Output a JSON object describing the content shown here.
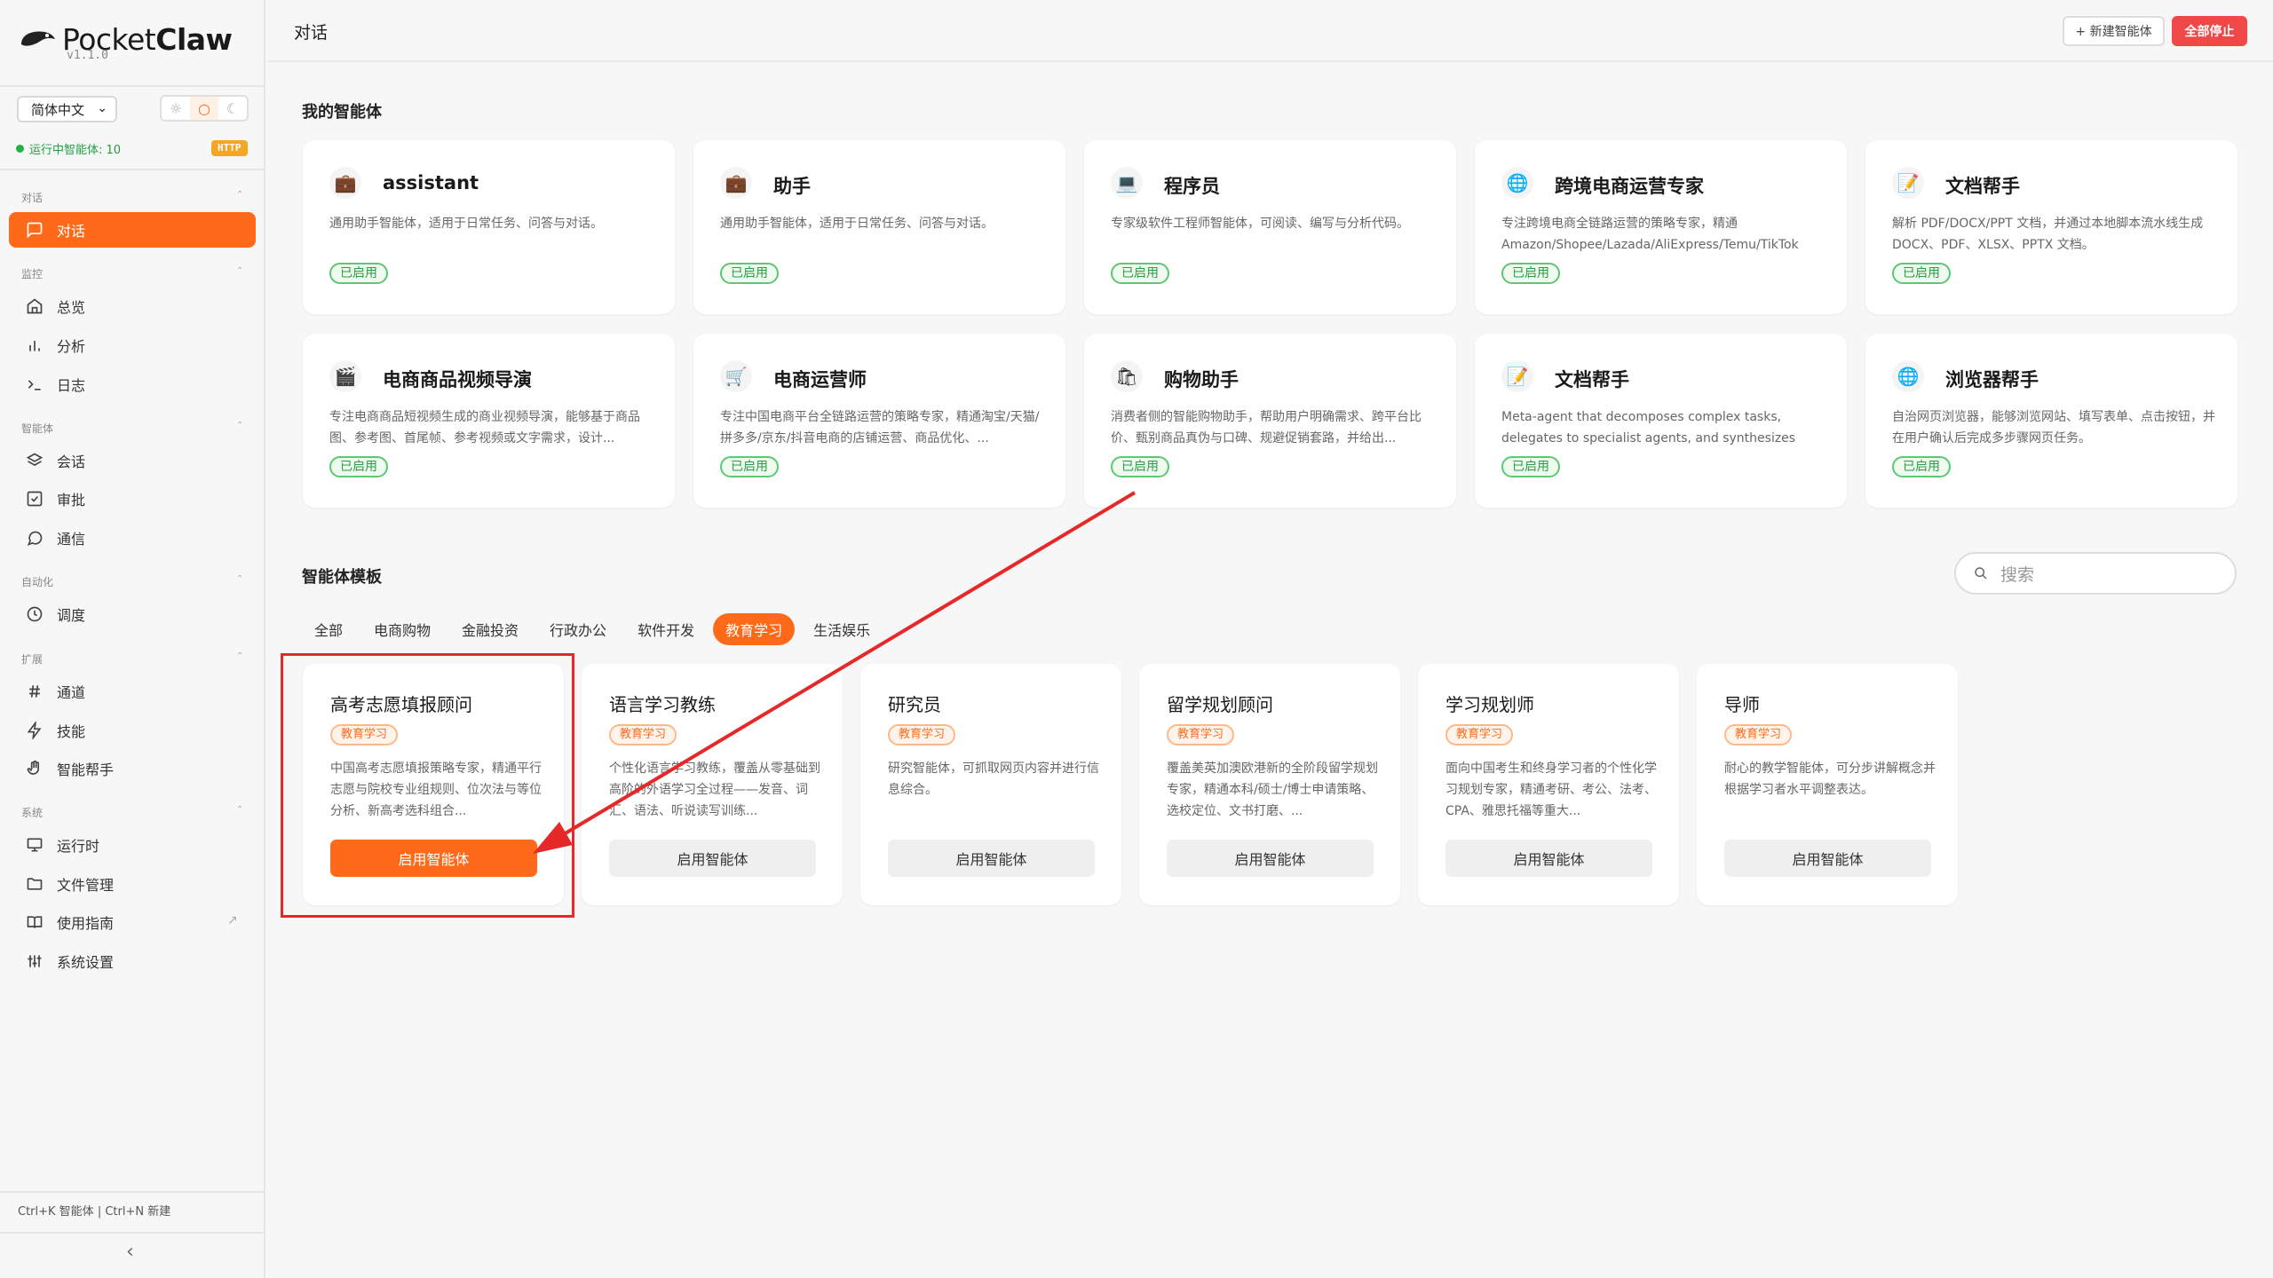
{
  "app": {
    "name_light": "Pocket",
    "name_bold": "Claw",
    "version": "v1.1.0"
  },
  "sidebar": {
    "language": "简体中文",
    "running_label": "运行中智能体: 10",
    "http_badge": "HTTP",
    "sections": [
      {
        "title": "对话",
        "items": [
          {
            "label": "对话",
            "icon": "chat-icon",
            "active": true
          }
        ]
      },
      {
        "title": "监控",
        "items": [
          {
            "label": "总览",
            "icon": "home-icon"
          },
          {
            "label": "分析",
            "icon": "bar-chart-icon"
          },
          {
            "label": "日志",
            "icon": "terminal-icon"
          }
        ]
      },
      {
        "title": "智能体",
        "items": [
          {
            "label": "会话",
            "icon": "layers-icon"
          },
          {
            "label": "审批",
            "icon": "check-square-icon"
          },
          {
            "label": "通信",
            "icon": "message-icon"
          }
        ]
      },
      {
        "title": "自动化",
        "items": [
          {
            "label": "调度",
            "icon": "clock-icon"
          }
        ]
      },
      {
        "title": "扩展",
        "items": [
          {
            "label": "通道",
            "icon": "hash-icon"
          },
          {
            "label": "技能",
            "icon": "zap-icon"
          },
          {
            "label": "智能帮手",
            "icon": "hand-icon"
          }
        ]
      },
      {
        "title": "系统",
        "items": [
          {
            "label": "运行时",
            "icon": "monitor-icon"
          },
          {
            "label": "文件管理",
            "icon": "folder-icon"
          },
          {
            "label": "使用指南",
            "icon": "book-icon"
          },
          {
            "label": "系统设置",
            "icon": "sliders-icon"
          }
        ]
      }
    ],
    "shortcut_hint": "Ctrl+K 智能体 | Ctrl+N 新建",
    "collapse_glyph": "‹"
  },
  "header": {
    "title": "对话",
    "new_agent": "+ 新建智能体",
    "stop_all": "全部停止"
  },
  "my_agents": {
    "title": "我的智能体",
    "items": [
      {
        "name": "assistant",
        "icon": "💼",
        "desc": "通用助手智能体，适用于日常任务、问答与对话。",
        "status": "已启用"
      },
      {
        "name": "助手",
        "icon": "💼",
        "desc": "通用助手智能体，适用于日常任务、问答与对话。",
        "status": "已启用"
      },
      {
        "name": "程序员",
        "icon": "💻",
        "desc": "专家级软件工程师智能体，可阅读、编写与分析代码。",
        "status": "已启用"
      },
      {
        "name": "跨境电商运营专家",
        "icon": "🌐",
        "desc": "专注跨境电商全链路运营的策略专家，精通Amazon/Shopee/Lazada/AliExpress/Temu/TikTok Sho...",
        "status": "已启用"
      },
      {
        "name": "文档帮手",
        "icon": "📝",
        "desc": "解析 PDF/DOCX/PPT 文档，并通过本地脚本流水线生成 DOCX、PDF、XLSX、PPTX 文档。",
        "status": "已启用"
      },
      {
        "name": "电商商品视频导演",
        "icon": "🎬",
        "desc": "专注电商商品短视频生成的商业视频导演，能够基于商品图、参考图、首尾帧、参考视频或文字需求，设计...",
        "status": "已启用"
      },
      {
        "name": "电商运营师",
        "icon": "🛒",
        "desc": "专注中国电商平台全链路运营的策略专家，精通淘宝/天猫/拼多多/京东/抖音电商的店铺运营、商品优化、...",
        "status": "已启用"
      },
      {
        "name": "购物助手",
        "icon": "🛍",
        "desc": "消费者侧的智能购物助手，帮助用户明确需求、跨平台比价、甄别商品真伪与口碑、规避促销套路，并给出...",
        "status": "已启用"
      },
      {
        "name": "文档帮手",
        "icon": "📝",
        "desc": "Meta-agent that decomposes complex tasks, delegates to specialist agents, and synthesizes results.",
        "status": "已启用"
      },
      {
        "name": "浏览器帮手",
        "icon": "🌐",
        "desc": "自治网页浏览器，能够浏览网站、填写表单、点击按钮，并在用户确认后完成多步骤网页任务。",
        "status": "已启用"
      }
    ]
  },
  "templates": {
    "title": "智能体模板",
    "search_placeholder": "搜索",
    "tabs": [
      "全部",
      "电商购物",
      "金融投资",
      "行政办公",
      "软件开发",
      "教育学习",
      "生活娱乐"
    ],
    "active_tab": 5,
    "items": [
      {
        "name": "高考志愿填报顾问",
        "tag": "教育学习",
        "desc": "中国高考志愿填报策略专家，精通平行志愿与院校专业组规则、位次法与等位分析、新高考选科组合...",
        "button": "启用智能体",
        "primary": true
      },
      {
        "name": "语言学习教练",
        "tag": "教育学习",
        "desc": "个性化语言学习教练，覆盖从零基础到高阶的外语学习全过程——发音、词汇、语法、听说读写训练...",
        "button": "启用智能体"
      },
      {
        "name": "研究员",
        "tag": "教育学习",
        "desc": "研究智能体，可抓取网页内容并进行信息综合。",
        "button": "启用智能体"
      },
      {
        "name": "留学规划顾问",
        "tag": "教育学习",
        "desc": "覆盖美英加澳欧港新的全阶段留学规划专家，精通本科/硕士/博士申请策略、选校定位、文书打磨、...",
        "button": "启用智能体"
      },
      {
        "name": "学习规划师",
        "tag": "教育学习",
        "desc": "面向中国考生和终身学习者的个性化学习规划专家，精通考研、考公、法考、CPA、雅思托福等重大...",
        "button": "启用智能体"
      },
      {
        "name": "导师",
        "tag": "教育学习",
        "desc": "耐心的教学智能体，可分步讲解概念并根据学习者水平调整表达。",
        "button": "启用智能体"
      }
    ]
  },
  "colors": {
    "accent": "#ff6a1a",
    "danger": "#f04747",
    "success": "#25a03f",
    "annotation": "#e62828"
  }
}
